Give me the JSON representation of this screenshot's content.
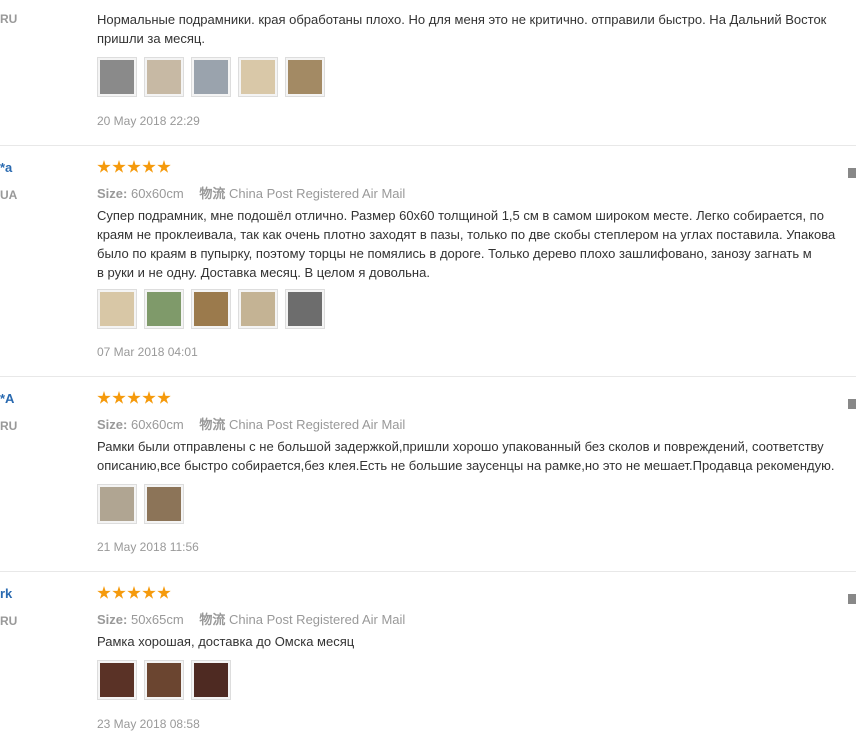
{
  "reviews": [
    {
      "name": "",
      "country": "RU",
      "text_lines": [
        "Нормальные подрамники. края обработаны плохо. Но для меня это не критично. отправили быстро. На Дальний Восток",
        "пришли за месяц."
      ],
      "date": "20 May 2018 22:29",
      "photos": [
        "#8a8a8a",
        "#c7b9a4",
        "#9aa3ad",
        "#d9c8a8",
        "#a38a64"
      ]
    },
    {
      "name": "*a",
      "country": "UA",
      "size_label": "Size:",
      "size_value": "60x60cm",
      "ship_label": "物流",
      "ship_value": "China Post Registered Air Mail",
      "text_lines": [
        "Супер подрамник, мне подошёл отлично. Размер 60х60 толщиной 1,5 см в самом широком месте. Легко собирается, по",
        "краям не проклеивала, так как очень плотно заходят в пазы, только по две скобы степлером на углах поставила. Упакова",
        "было по краям в пупырку, поэтому торцы не помялись в дороге. Только дерево плохо зашлифовано, занозу загнать м",
        "в руки и не одну. Доставка месяц. В целом я довольна."
      ],
      "date": "07 Mar 2018 04:01",
      "photos": [
        "#d8c7a6",
        "#7f9a6a",
        "#9b7a4c",
        "#c4b394",
        "#6d6d6d"
      ]
    },
    {
      "name": "*A",
      "country": "RU",
      "size_label": "Size:",
      "size_value": "60x60cm",
      "ship_label": "物流",
      "ship_value": "China Post Registered Air Mail",
      "text_lines": [
        "Рамки были отправлены с не большой задержкой,пришли хорошо упакованный без сколов и повреждений, соответству",
        "описанию,все быстро собирается,без клея.Есть не большие заусенцы на рамке,но это не мешает.Продавца рекомендую."
      ],
      "date": "21 May 2018 11:56",
      "photos": [
        "#b0a592",
        "#8c7458"
      ]
    },
    {
      "name": "rk",
      "country": "RU",
      "size_label": "Size:",
      "size_value": "50x65cm",
      "ship_label": "物流",
      "ship_value": "China Post Registered Air Mail",
      "text_lines": [
        "Рамка хорошая, доставка до Омска месяц"
      ],
      "date": "23 May 2018 08:58",
      "photos": [
        "#5a3226",
        "#6b4530",
        "#4e2a22"
      ]
    }
  ]
}
